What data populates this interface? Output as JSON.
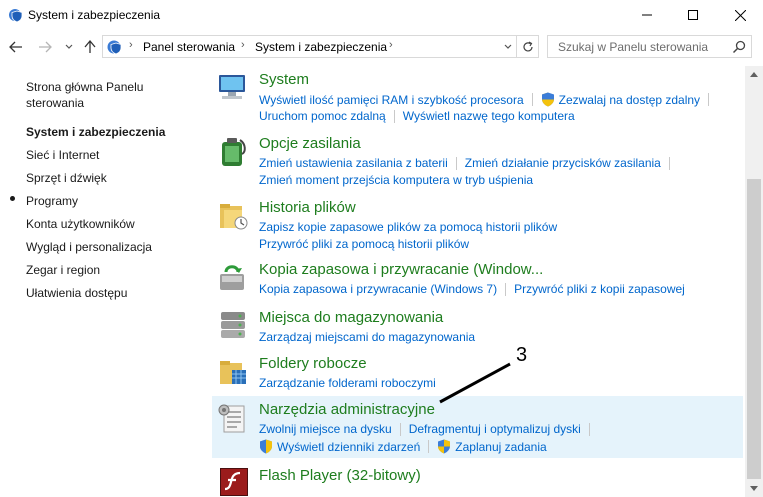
{
  "window": {
    "title": "System i zabezpieczenia",
    "icon": "control-panel-shield-icon"
  },
  "addressbar": {
    "crumbs": [
      "Panel sterowania",
      "System i zabezpieczenia"
    ],
    "search_placeholder": "Szukaj w Panelu sterowania"
  },
  "leftnav": {
    "items": [
      {
        "label": "Strona główna Panelu sterowania",
        "active": false
      },
      {
        "label": "System i zabezpieczenia",
        "active": true
      },
      {
        "label": "Sieć i Internet",
        "active": false
      },
      {
        "label": "Sprzęt i dźwięk",
        "active": false
      },
      {
        "label": "Programy",
        "active": false
      },
      {
        "label": "Konta użytkowników",
        "active": false
      },
      {
        "label": "Wygląd i personalizacja",
        "active": false
      },
      {
        "label": "Zegar i region",
        "active": false
      },
      {
        "label": "Ułatwienia dostępu",
        "active": false
      }
    ]
  },
  "categories": [
    {
      "title": "System",
      "icon": "computer-monitor-icon",
      "rows": [
        [
          "Wyświetl ilość pamięci RAM i szybkość procesora",
          "Zezwalaj na dostęp zdalny"
        ],
        [
          "Uruchom pomoc zdalną",
          "Wyświetl nazwę tego komputera"
        ]
      ]
    },
    {
      "title": "Opcje zasilania",
      "icon": "battery-power-icon",
      "rows": [
        [
          "Zmień ustawienia zasilania z baterii",
          "Zmień działanie przycisków zasilania"
        ],
        [
          "Zmień moment przejścia komputera w tryb uśpienia"
        ]
      ]
    },
    {
      "title": "Historia plików",
      "icon": "file-history-folder-icon",
      "rows": [
        [
          "Zapisz kopie zapasowe plików za pomocą historii plików"
        ],
        [
          "Przywróć pliki za pomocą historii plików"
        ]
      ]
    },
    {
      "title": "Kopia zapasowa i przywracanie (Window...",
      "icon": "backup-restore-icon",
      "rows": [
        [
          "Kopia zapasowa i przywracanie (Windows 7)",
          "Przywróć pliki z kopii zapasowej"
        ]
      ]
    },
    {
      "title": "Miejsca do magazynowania",
      "icon": "storage-spaces-icon",
      "rows": [
        [
          "Zarządzaj miejscami do magazynowania"
        ]
      ]
    },
    {
      "title": "Foldery robocze",
      "icon": "work-folders-icon",
      "rows": [
        [
          "Zarządzanie folderami roboczymi"
        ]
      ]
    },
    {
      "title": "Narzędzia administracyjne",
      "icon": "administrative-tools-icon",
      "rows": [
        [
          "Zwolnij miejsce na dysku",
          "Defragmentuj i optymalizuj dyski"
        ],
        [
          "Wyświetl dzienniki zdarzeń",
          "Zaplanuj zadania"
        ]
      ]
    },
    {
      "title": "Flash Player (32-bitowy)",
      "icon": "flash-player-icon",
      "rows": []
    }
  ],
  "annotation": {
    "number": "3"
  },
  "colors": {
    "link": "#0066cc",
    "category_title": "#1e7d1e",
    "highlight": "#e5f3fb"
  }
}
